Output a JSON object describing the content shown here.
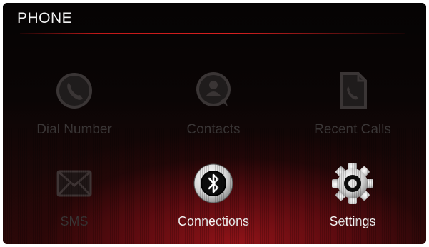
{
  "header": {
    "title": "PHONE"
  },
  "menu": {
    "dial_number": {
      "label": "Dial Number",
      "icon": "phone-handset-icon",
      "enabled": false
    },
    "contacts": {
      "label": "Contacts",
      "icon": "contact-person-icon",
      "enabled": false
    },
    "recent_calls": {
      "label": "Recent Calls",
      "icon": "recent-calls-icon",
      "enabled": false
    },
    "sms": {
      "label": "SMS",
      "icon": "envelope-icon",
      "enabled": false
    },
    "connections": {
      "label": "Connections",
      "icon": "bluetooth-icon",
      "enabled": true
    },
    "settings": {
      "label": "Settings",
      "icon": "gear-icon",
      "enabled": true
    }
  },
  "colors": {
    "accent_red": "#c01818",
    "label_active": "#f5f5f5",
    "label_disabled": "#3a3636"
  }
}
